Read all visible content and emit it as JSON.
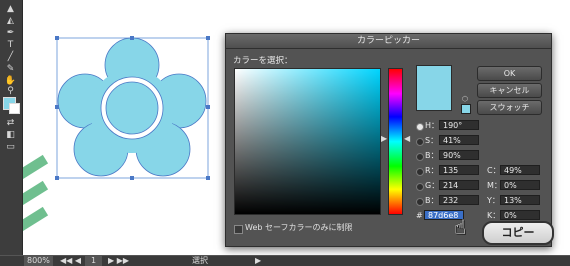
{
  "canvas": {
    "accent_fill": "#87d6e8",
    "stripe_color": "#6fbf8f"
  },
  "toolbar": {
    "tools": [
      "selection-tool-icon",
      "group-select-icon",
      "pen-tool-icon",
      "type-tool-icon",
      "line-tool-icon",
      "brush-tool-icon",
      "hand-tool-icon",
      "zoom-tool-icon"
    ]
  },
  "dialog": {
    "title": "カラーピッカー",
    "select_label": "カラーを選択：",
    "buttons": {
      "ok": "OK",
      "cancel": "キャンセル",
      "swatches": "スウォッチ"
    },
    "fields": {
      "h": {
        "label": "H：",
        "value": "190°"
      },
      "s": {
        "label": "S：",
        "value": "41%"
      },
      "b": {
        "label": "B：",
        "value": "90%"
      },
      "r": {
        "label": "R：",
        "value": "135"
      },
      "g": {
        "label": "G：",
        "value": "214"
      },
      "b2": {
        "label": "B：",
        "value": "232"
      },
      "c": {
        "label": "C：",
        "value": "49%"
      },
      "m": {
        "label": "M：",
        "value": "0%"
      },
      "y": {
        "label": "Y：",
        "value": "13%"
      },
      "k": {
        "label": "K：",
        "value": "0%"
      },
      "hex": {
        "label": "#",
        "value": "87d6e8"
      }
    },
    "websafe_label": "Web セーフカラーのみに制限",
    "new_color": "#87d6e8"
  },
  "overlay": {
    "copy_label": "コピー"
  },
  "statusbar": {
    "zoom": "800%",
    "page": "1",
    "tool_name": "選択"
  }
}
